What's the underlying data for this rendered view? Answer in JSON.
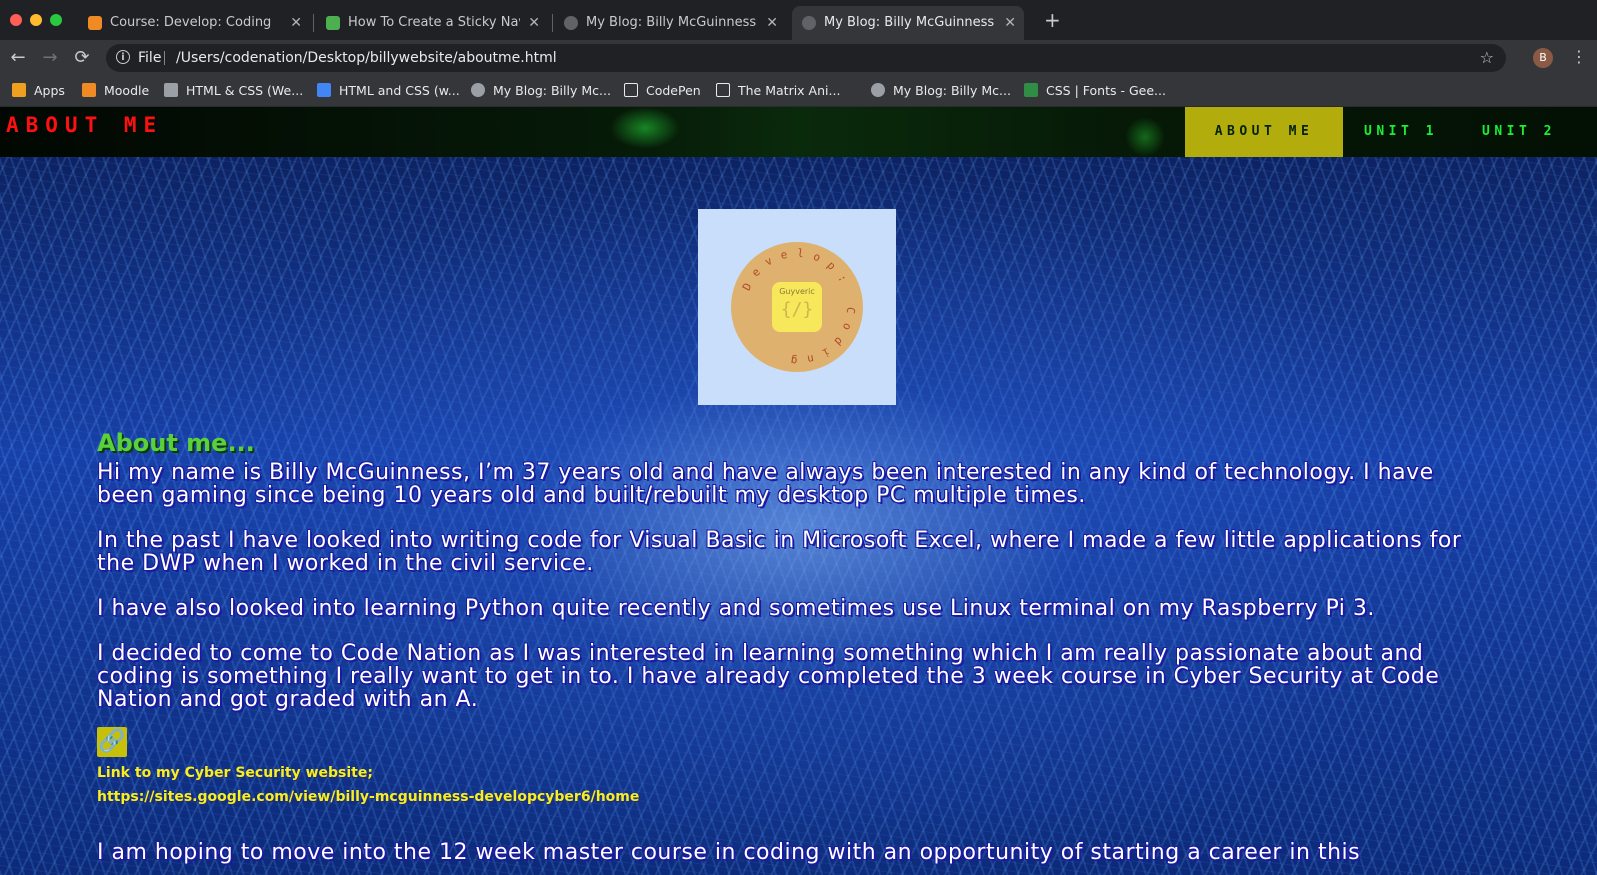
{
  "browser": {
    "tabs": [
      {
        "title": "Course: Develop: Coding",
        "icon_color": "#f08a24",
        "active": false
      },
      {
        "title": "How To Create a Sticky Navbar",
        "icon_color": "#4caf50",
        "active": false
      },
      {
        "title": "My Blog: Billy McGuinness - De",
        "icon_color": "#5f6368",
        "active": false
      },
      {
        "title": "My Blog: Billy McGuinness - De",
        "icon_color": "#5f6368",
        "active": true
      }
    ],
    "new_tab_glyph": "+",
    "toolbar": {
      "back": "←",
      "forward": "→",
      "reload": "⟳",
      "info": "i",
      "scheme": "File",
      "url": "/Users/codenation/Desktop/billywebsite/aboutme.html",
      "star": "☆",
      "profile_initial": "B",
      "menu": "⋮"
    },
    "bookmarks": [
      {
        "label": "Apps",
        "icon": "apps-grid-icon",
        "icon_color": "#f0a020"
      },
      {
        "label": "Moodle",
        "icon": "moodle-icon",
        "icon_color": "#f08a24"
      },
      {
        "label": "HTML & CSS (We...",
        "icon": "html-css-icon",
        "icon_color": "#9aa0a6"
      },
      {
        "label": "HTML and CSS (w...",
        "icon": "docs-icon",
        "icon_color": "#4285f4"
      },
      {
        "label": "My Blog: Billy Mc...",
        "icon": "globe-icon",
        "icon_color": "#9aa0a6"
      },
      {
        "label": "CodePen",
        "icon": "codepen-icon",
        "icon_color": "#e8eaed"
      },
      {
        "label": "The Matrix Ani...",
        "icon": "codepen-icon",
        "icon_color": "#e8eaed"
      },
      {
        "label": "My Blog: Billy Mc...",
        "icon": "globe-icon",
        "icon_color": "#9aa0a6"
      },
      {
        "label": "CSS | Fonts - Gee...",
        "icon": "gfg-icon",
        "icon_color": "#2f8d46"
      }
    ]
  },
  "site": {
    "title": "ABOUT ME",
    "nav": [
      {
        "label": "ABOUT ME",
        "active": true
      },
      {
        "label": "UNIT 1",
        "active": false
      },
      {
        "label": "UNIT 2",
        "active": false
      }
    ],
    "logo": {
      "brand": "Guyveric",
      "code": "{/}",
      "ring_text": "Develop: Coding"
    },
    "content": {
      "heading": "About me...",
      "paragraphs": [
        "Hi my name is Billy McGuinness, I’m 37 years old and have always been interested in any kind of technology. I have been gaming since being 10 years old and built/rebuilt my desktop PC multiple times.",
        "In the past I have looked into writing code for Visual Basic in Microsoft Excel, where I made a few little applications for the DWP when I worked in the civil service.",
        "I have also looked into learning Python quite recently and sometimes use Linux terminal on my Raspberry Pi 3.",
        "I decided to come to Code Nation as I was interested in learning something which I am really passionate about and coding is something I really want to get in to. I have already completed the 3 week course in Cyber Security at Code Nation and got graded with an A."
      ],
      "link_icon": "🔗",
      "link_label": "Link to my Cyber Security website;",
      "link_url": "https://sites.google.com/view/billy-mcguinness-developcyber6/home",
      "partial_paragraph": "I am hoping to move into the 12 week master course in coding with an opportunity of starting a career in this"
    }
  }
}
